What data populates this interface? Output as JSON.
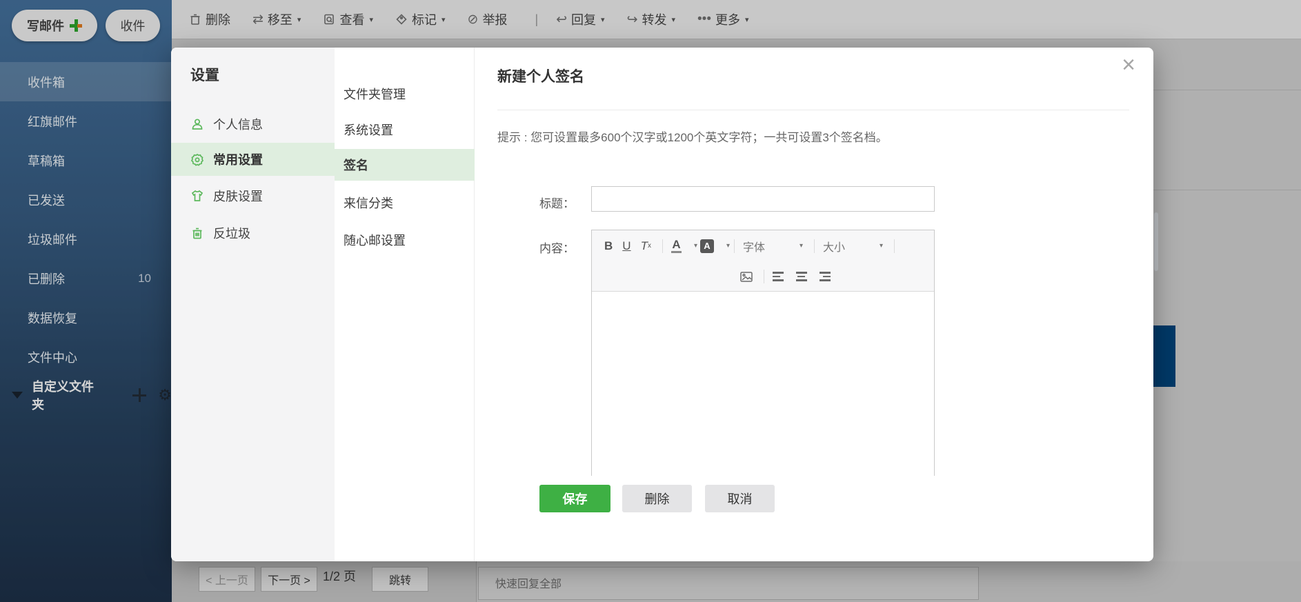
{
  "sidebar": {
    "compose_label": "写邮件",
    "receive_label": "收件",
    "folders": [
      {
        "label": "收件箱"
      },
      {
        "label": "红旗邮件"
      },
      {
        "label": "草稿箱"
      },
      {
        "label": "已发送"
      },
      {
        "label": "垃圾邮件"
      },
      {
        "label": "已删除",
        "count": "10"
      },
      {
        "label": "数据恢复"
      },
      {
        "label": "文件中心"
      }
    ],
    "custom_folder_label": "自定义文件夹"
  },
  "toolbar": {
    "delete": "删除",
    "move": "移至",
    "view": "查看",
    "mark": "标记",
    "report": "举报",
    "reply": "回复",
    "forward": "转发",
    "more": "更多"
  },
  "settings": {
    "title": "设置",
    "nav": [
      {
        "label": "个人信息"
      },
      {
        "label": "常用设置"
      },
      {
        "label": "皮肤设置"
      },
      {
        "label": "反垃圾"
      }
    ],
    "subnav": [
      {
        "label": "文件夹管理"
      },
      {
        "label": "系统设置"
      },
      {
        "label": "签名"
      },
      {
        "label": "来信分类"
      },
      {
        "label": "随心邮设置"
      }
    ]
  },
  "signature_panel": {
    "title": "新建个人签名",
    "hint": "提示 : 您可设置最多600个汉字或1200个英文字符；一共可设置3个签名档。",
    "title_label": "标题：",
    "content_label": "内容：",
    "title_value": "",
    "editor": {
      "bold": "B",
      "underline": "U",
      "font_label": "字体",
      "size_label": "大小"
    },
    "buttons": {
      "save": "保存",
      "delete": "删除",
      "cancel": "取消"
    }
  },
  "pagination": {
    "prev": "< 上一页",
    "next": "下一页 >",
    "page_info": "1/2 页",
    "jump": "跳转"
  },
  "quick_reply_label": "快速回复全部",
  "icons": {
    "caret_down": "▾",
    "close": "×",
    "more_dots": "•••",
    "separator": "|",
    "gear": "⚙",
    "move_arrows": "⇄",
    "report_slash": "⊘",
    "reply_arrow": "↩",
    "forward_arrow": "↪"
  },
  "colors": {
    "accent_green": "#3eb044",
    "selected_green": "#dfeedf",
    "sidebar_blue_top": "#44719d",
    "sidebar_blue_bottom": "#1d3048",
    "navy_button": "#00457c"
  }
}
